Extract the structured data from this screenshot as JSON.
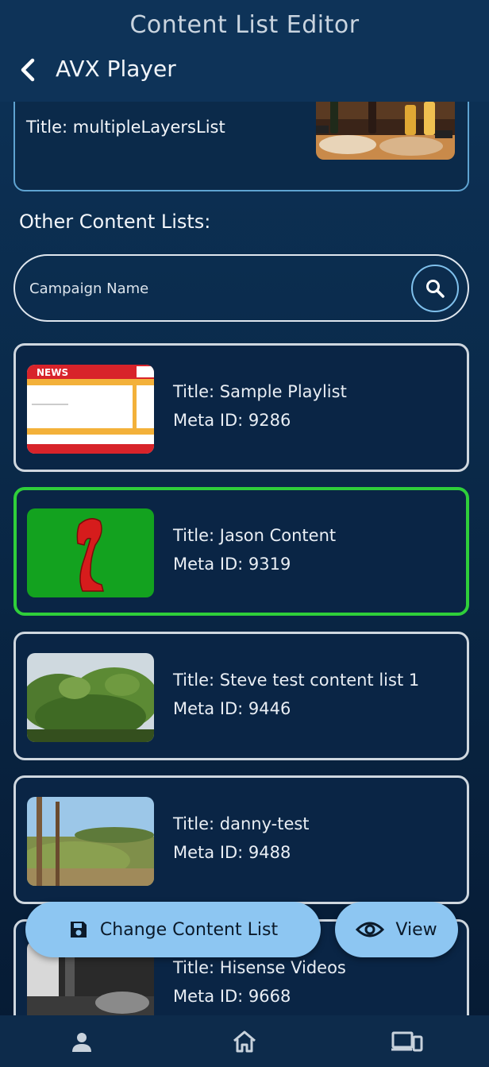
{
  "app": {
    "title": "Content List Editor"
  },
  "header": {
    "back_icon": "chevron-left-icon",
    "screen_title": "AVX Player"
  },
  "current": {
    "title": "Title: multipleLayersList"
  },
  "section": {
    "other_label": "Other Content Lists:"
  },
  "search": {
    "placeholder": "Campaign Name",
    "value": "",
    "icon": "search-icon"
  },
  "items": [
    {
      "title": "Title: Sample Playlist",
      "meta": "Meta ID: 9286",
      "selected": false
    },
    {
      "title": "Title: Jason Content",
      "meta": "Meta ID: 9319",
      "selected": true
    },
    {
      "title": "Title: Steve test content list 1",
      "meta": "Meta ID: 9446",
      "selected": false
    },
    {
      "title": "Title: danny-test",
      "meta": "Meta ID: 9488",
      "selected": false
    },
    {
      "title": "Title: Hisense Videos",
      "meta": "Meta ID: 9668",
      "selected": false
    }
  ],
  "actions": {
    "change_label": "Change Content List",
    "change_icon": "save-icon",
    "view_label": "View",
    "view_icon": "eye-icon"
  },
  "nav": [
    {
      "icon": "person-icon"
    },
    {
      "icon": "home-icon"
    },
    {
      "icon": "devices-icon"
    }
  ],
  "colors": {
    "background": "#0a2a4a",
    "accent": "#8dc6f2",
    "selected_border": "#2fcf3a",
    "card_border": "#cfd7df",
    "current_border": "#5fa3d1"
  }
}
